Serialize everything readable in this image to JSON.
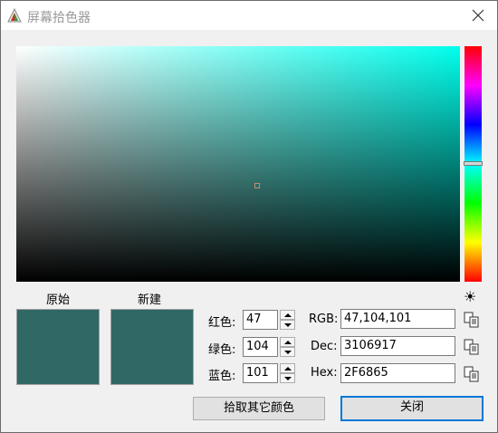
{
  "window": {
    "title": "屏幕拾色器"
  },
  "swatches": {
    "original_label": "原始",
    "new_label": "新建",
    "original_color": "#2f6865",
    "new_color": "#2f6865"
  },
  "picker": {
    "hue_color": "#00ffed",
    "brightness_icon": "brightness-icon"
  },
  "rgb": {
    "red_label": "红色:",
    "red_value": "47",
    "green_label": "绿色:",
    "green_value": "104",
    "blue_label": "蓝色:",
    "blue_value": "101"
  },
  "formats": {
    "rgb_label": "RGB:",
    "rgb_value": "47,104,101",
    "dec_label": "Dec:",
    "dec_value": "3106917",
    "hex_label": "Hex:",
    "hex_value": "2F6865"
  },
  "buttons": {
    "pick_label": "拾取其它颜色",
    "close_label": "关闭"
  }
}
